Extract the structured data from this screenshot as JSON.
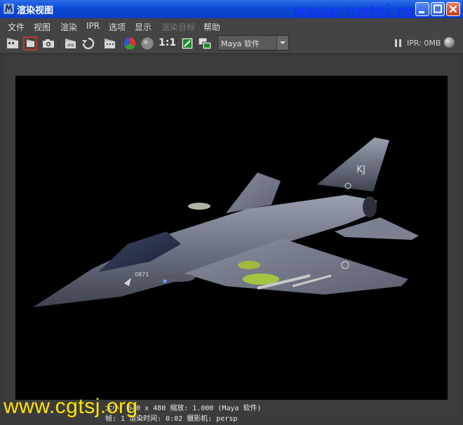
{
  "window": {
    "title": "渲染视图"
  },
  "watermark": {
    "text": "www.cgtsj.org"
  },
  "menu": [
    "文件",
    "视图",
    "渲染",
    "IPR",
    "选项",
    "显示",
    "渲染目标",
    "帮助"
  ],
  "toolbar": {
    "icons": [
      "redo-render-icon",
      "render-region-icon",
      "snapshot-icon",
      "ipr-render-icon",
      "refresh-ipr-icon",
      "render-settings-icon",
      "rgb-channels-icon",
      "alpha-channel-icon",
      "real-size-icon",
      "keep-image-icon",
      "remove-image-icon"
    ],
    "ratio_label": "1:1",
    "renderer": "Maya 软件",
    "ipr_status": "IPR: 0MB"
  },
  "render": {
    "canvas_color": "#000000",
    "aircraft_tail_code": "KJ",
    "aircraft_nose_number": "0871"
  },
  "status": {
    "line1": "大小: 640 x 480  缩放: 1.000       (Maya 软件)",
    "line2": "帧: 1        渲染时间: 0:02         摄影机: persp"
  },
  "colors": {
    "title_blue": "#0a49d6",
    "watermark_top": "#1a2cff",
    "watermark_bottom": "#ffe300",
    "panel": "#444444"
  }
}
